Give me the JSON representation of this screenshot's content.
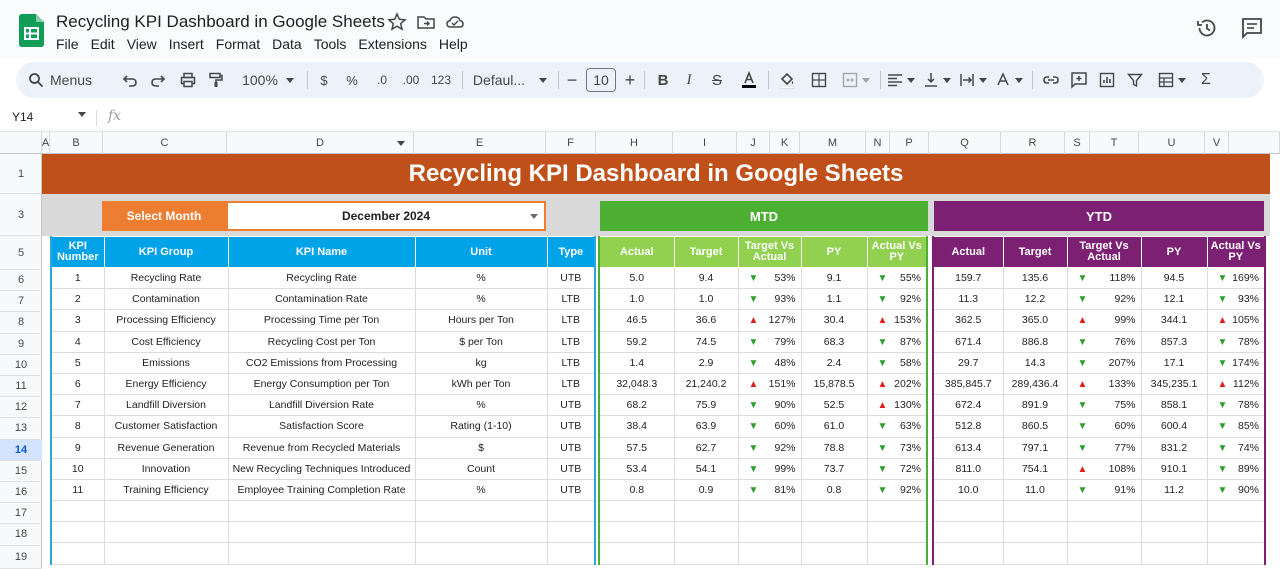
{
  "app": {
    "doc_title": "Recycling KPI Dashboard in Google Sheets",
    "menu": [
      "File",
      "Edit",
      "View",
      "Insert",
      "Format",
      "Data",
      "Tools",
      "Extensions",
      "Help"
    ]
  },
  "toolbar": {
    "search_label": "Menus",
    "zoom": "100%",
    "currency": "$",
    "percent": "%",
    "decimal_dec": ".0",
    "decimal_inc": ".00",
    "number_format": "123",
    "font": "Defaul...",
    "font_size": "10"
  },
  "formula_bar": {
    "name_box": "Y14",
    "fx": "fx"
  },
  "columns": [
    "A",
    "B",
    "C",
    "D",
    "E",
    "F",
    "H",
    "I",
    "J",
    "K",
    "M",
    "N",
    "P",
    "Q",
    "R",
    "S",
    "T",
    "U",
    "V"
  ],
  "rows": [
    "1",
    "3",
    "5",
    "6",
    "7",
    "8",
    "9",
    "10",
    "11",
    "12",
    "13",
    "14",
    "15",
    "16",
    "17",
    "18",
    "19"
  ],
  "selected_row": "14",
  "dashboard": {
    "title": "Recycling KPI Dashboard in Google Sheets",
    "select_month_label": "Select Month",
    "selected_month": "December 2024",
    "mtd_label": "MTD",
    "ytd_label": "YTD",
    "kpi_headers": [
      "KPI Number",
      "KPI Group",
      "KPI Name",
      "Unit",
      "Type"
    ],
    "period_headers": [
      "Actual",
      "Target",
      "Target Vs Actual",
      "PY",
      "Actual Vs PY"
    ],
    "colors": {
      "banner": "#c0501a",
      "select_month": "#ed7d31",
      "mtd": "#4caf32",
      "ytd": "#7b2073",
      "kpi_header": "#00a2e8",
      "mtd_header": "#92d050",
      "arrow_up": "#e02020",
      "arrow_down": "#2e9d2e"
    },
    "rows": [
      {
        "num": "1",
        "group": "Recycling Rate",
        "name": "Recycling Rate",
        "unit": "%",
        "type": "UTB",
        "mtd": {
          "actual": "5.0",
          "target": "9.4",
          "tva_dir": "down",
          "tva": "53%",
          "py": "9.1",
          "avp_dir": "down",
          "avp": "55%"
        },
        "ytd": {
          "actual": "159.7",
          "target": "135.6",
          "tva_dir": "down",
          "tva": "118%",
          "py": "94.5",
          "avp_dir": "down",
          "avp": "169%"
        }
      },
      {
        "num": "2",
        "group": "Contamination",
        "name": "Contamination Rate",
        "unit": "%",
        "type": "LTB",
        "mtd": {
          "actual": "1.0",
          "target": "1.0",
          "tva_dir": "down",
          "tva": "93%",
          "py": "1.1",
          "avp_dir": "down",
          "avp": "92%"
        },
        "ytd": {
          "actual": "11.3",
          "target": "12.2",
          "tva_dir": "down",
          "tva": "92%",
          "py": "12.1",
          "avp_dir": "down",
          "avp": "93%"
        }
      },
      {
        "num": "3",
        "group": "Processing Efficiency",
        "name": "Processing Time per Ton",
        "unit": "Hours per Ton",
        "type": "LTB",
        "mtd": {
          "actual": "46.5",
          "target": "36.6",
          "tva_dir": "up",
          "tva": "127%",
          "py": "30.4",
          "avp_dir": "up",
          "avp": "153%"
        },
        "ytd": {
          "actual": "362.5",
          "target": "365.0",
          "tva_dir": "up",
          "tva": "99%",
          "py": "344.1",
          "avp_dir": "up",
          "avp": "105%"
        }
      },
      {
        "num": "4",
        "group": "Cost Efficiency",
        "name": "Recycling Cost per Ton",
        "unit": "$ per Ton",
        "type": "LTB",
        "mtd": {
          "actual": "59.2",
          "target": "74.5",
          "tva_dir": "down",
          "tva": "79%",
          "py": "68.3",
          "avp_dir": "down",
          "avp": "87%"
        },
        "ytd": {
          "actual": "671.4",
          "target": "886.8",
          "tva_dir": "down",
          "tva": "76%",
          "py": "857.3",
          "avp_dir": "down",
          "avp": "78%"
        }
      },
      {
        "num": "5",
        "group": "Emissions",
        "name": "CO2 Emissions from Processing",
        "unit": "kg",
        "type": "LTB",
        "mtd": {
          "actual": "1.4",
          "target": "2.9",
          "tva_dir": "down",
          "tva": "48%",
          "py": "2.4",
          "avp_dir": "down",
          "avp": "58%"
        },
        "ytd": {
          "actual": "29.7",
          "target": "14.3",
          "tva_dir": "down",
          "tva": "207%",
          "py": "17.1",
          "avp_dir": "down",
          "avp": "174%"
        }
      },
      {
        "num": "6",
        "group": "Energy Efficiency",
        "name": "Energy Consumption per Ton",
        "unit": "kWh per Ton",
        "type": "LTB",
        "mtd": {
          "actual": "32,048.3",
          "target": "21,240.2",
          "tva_dir": "up",
          "tva": "151%",
          "py": "15,878.5",
          "avp_dir": "up",
          "avp": "202%"
        },
        "ytd": {
          "actual": "385,845.7",
          "target": "289,436.4",
          "tva_dir": "up",
          "tva": "133%",
          "py": "345,235.1",
          "avp_dir": "up",
          "avp": "112%"
        }
      },
      {
        "num": "7",
        "group": "Landfill Diversion",
        "name": "Landfill Diversion Rate",
        "unit": "%",
        "type": "UTB",
        "mtd": {
          "actual": "68.2",
          "target": "75.9",
          "tva_dir": "down",
          "tva": "90%",
          "py": "52.5",
          "avp_dir": "up",
          "avp": "130%"
        },
        "ytd": {
          "actual": "672.4",
          "target": "891.9",
          "tva_dir": "down",
          "tva": "75%",
          "py": "858.1",
          "avp_dir": "down",
          "avp": "78%"
        }
      },
      {
        "num": "8",
        "group": "Customer Satisfaction",
        "name": "Satisfaction Score",
        "unit": "Rating (1-10)",
        "type": "UTB",
        "mtd": {
          "actual": "38.4",
          "target": "63.9",
          "tva_dir": "down",
          "tva": "60%",
          "py": "61.0",
          "avp_dir": "down",
          "avp": "63%"
        },
        "ytd": {
          "actual": "512.8",
          "target": "860.5",
          "tva_dir": "down",
          "tva": "60%",
          "py": "600.4",
          "avp_dir": "down",
          "avp": "85%"
        }
      },
      {
        "num": "9",
        "group": "Revenue Generation",
        "name": "Revenue from Recycled Materials",
        "unit": "$",
        "type": "UTB",
        "mtd": {
          "actual": "57.5",
          "target": "62.7",
          "tva_dir": "down",
          "tva": "92%",
          "py": "78.8",
          "avp_dir": "down",
          "avp": "73%"
        },
        "ytd": {
          "actual": "613.4",
          "target": "797.1",
          "tva_dir": "down",
          "tva": "77%",
          "py": "831.2",
          "avp_dir": "down",
          "avp": "74%"
        }
      },
      {
        "num": "10",
        "group": "Innovation",
        "name": "New Recycling Techniques Introduced",
        "unit": "Count",
        "type": "UTB",
        "mtd": {
          "actual": "53.4",
          "target": "54.1",
          "tva_dir": "down",
          "tva": "99%",
          "py": "73.7",
          "avp_dir": "down",
          "avp": "72%"
        },
        "ytd": {
          "actual": "811.0",
          "target": "754.1",
          "tva_dir": "up",
          "tva": "108%",
          "py": "910.1",
          "avp_dir": "down",
          "avp": "89%"
        }
      },
      {
        "num": "11",
        "group": "Training Efficiency",
        "name": "Employee Training Completion Rate",
        "unit": "%",
        "type": "UTB",
        "mtd": {
          "actual": "0.8",
          "target": "0.9",
          "tva_dir": "down",
          "tva": "81%",
          "py": "0.8",
          "avp_dir": "down",
          "avp": "92%"
        },
        "ytd": {
          "actual": "10.0",
          "target": "11.0",
          "tva_dir": "down",
          "tva": "91%",
          "py": "11.2",
          "avp_dir": "down",
          "avp": "90%"
        }
      }
    ]
  }
}
